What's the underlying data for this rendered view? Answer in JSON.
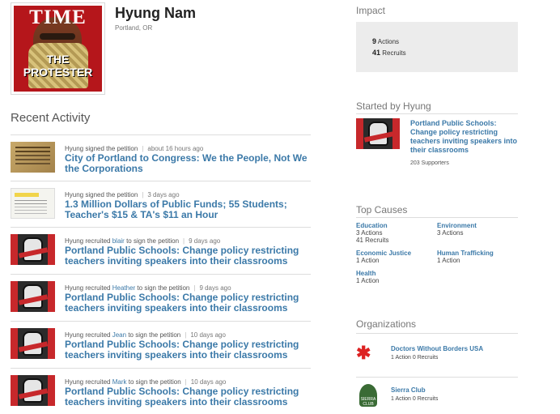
{
  "profile": {
    "name": "Hyung Nam",
    "location": "Portland, OR",
    "cover_title": "TIME",
    "cover_subtitle": "THE PROTESTER"
  },
  "recent_activity": {
    "title": "Recent Activity",
    "items": [
      {
        "actor": "Hyung signed the petition",
        "time": "about 16 hours ago",
        "title": "City of Portland to Congress: We the People, Not We the Corporations",
        "thumb": "document-icon"
      },
      {
        "actor": "Hyung signed the petition",
        "time": "3 days ago",
        "title": "1.3 Million Dollars of Public Funds; 55 Students; Teacher's $15 & TA's $11 an Hour",
        "thumb": "sheet-icon"
      },
      {
        "actor_prefix": "Hyung recruited",
        "actor_link": "blair",
        "actor_suffix": "to sign the petition",
        "time": "9 days ago",
        "title": "Portland Public Schools: Change policy restricting teachers inviting speakers into their classrooms",
        "thumb": "fist-icon"
      },
      {
        "actor_prefix": "Hyung recruited",
        "actor_link": "Heather",
        "actor_suffix": "to sign the petition",
        "time": "9 days ago",
        "title": "Portland Public Schools: Change policy restricting teachers inviting speakers into their classrooms",
        "thumb": "fist-icon"
      },
      {
        "actor_prefix": "Hyung recruited",
        "actor_link": "Jean",
        "actor_suffix": "to sign the petition",
        "time": "10 days ago",
        "title": "Portland Public Schools: Change policy restricting teachers inviting speakers into their classrooms",
        "thumb": "fist-icon"
      },
      {
        "actor_prefix": "Hyung recruited",
        "actor_link": "Mark",
        "actor_suffix": "to sign the petition",
        "time": "10 days ago",
        "title": "Portland Public Schools: Change policy restricting teachers inviting speakers into their classrooms",
        "thumb": "fist-icon"
      }
    ]
  },
  "impact": {
    "title": "Impact",
    "actions_count": "9",
    "actions_label": "Actions",
    "recruits_count": "41",
    "recruits_label": "Recruits"
  },
  "started": {
    "title": "Started by Hyung",
    "petition": "Portland Public Schools: Change policy restricting teachers inviting speakers into their classrooms",
    "supporters": "203 Supporters"
  },
  "top_causes": {
    "title": "Top Causes",
    "items": [
      {
        "name": "Education",
        "line1": "3 Actions",
        "line2": "41 Recruits"
      },
      {
        "name": "Environment",
        "line1": "3 Actions",
        "line2": ""
      },
      {
        "name": "Economic Justice",
        "line1": "1 Action",
        "line2": ""
      },
      {
        "name": "Human Trafficking",
        "line1": "1 Action",
        "line2": ""
      },
      {
        "name": "Health",
        "line1": "1 Action",
        "line2": ""
      }
    ]
  },
  "organizations": {
    "title": "Organizations",
    "items": [
      {
        "name": "Doctors Without Borders USA",
        "stats": "1 Action 0 Recruits",
        "logo": "msf-logo-icon"
      },
      {
        "name": "Sierra Club",
        "stats": "1 Action 0 Recruits",
        "logo": "sierra-club-logo-icon",
        "logo_text": "SIERRA CLUB"
      }
    ]
  },
  "colors": {
    "link": "#3b79a8",
    "cover_red": "#b5161b",
    "panel_gray": "#ececec"
  }
}
